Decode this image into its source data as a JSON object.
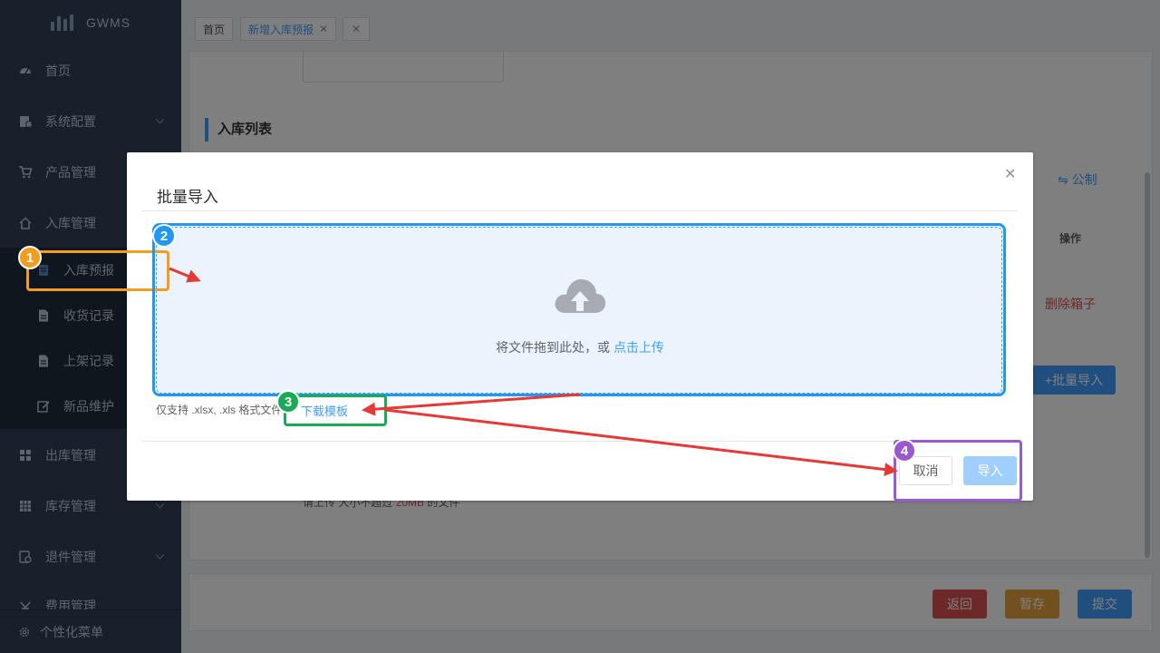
{
  "app": {
    "logo_text": "GWMS"
  },
  "sidebar": {
    "items": [
      {
        "label": "首页",
        "icon": "dashboard-icon"
      },
      {
        "label": "系统配置",
        "icon": "config-icon"
      },
      {
        "label": "产品管理",
        "icon": "cart-icon"
      },
      {
        "label": "入库管理",
        "icon": "home-icon"
      },
      {
        "label": "出库管理",
        "icon": "grid-icon"
      },
      {
        "label": "库存管理",
        "icon": "table-icon"
      },
      {
        "label": "退件管理",
        "icon": "return-icon"
      },
      {
        "label": "费用管理",
        "icon": "yen-icon"
      }
    ],
    "subitems": [
      {
        "label": "入库预报",
        "icon": "forecast-icon"
      },
      {
        "label": "收货记录",
        "icon": "document-icon"
      },
      {
        "label": "上架记录",
        "icon": "document-icon"
      },
      {
        "label": "新品维护",
        "icon": "edit-icon"
      }
    ],
    "footer_label": "个性化菜单"
  },
  "tabs": [
    {
      "label": "首页"
    },
    {
      "label": "新增入库预报"
    }
  ],
  "page": {
    "section_title": "入库列表",
    "bg_texts": {
      "link_partial": "⇋ 公制",
      "column_header": "操作",
      "delete_box": "删除箱子",
      "batch_import": "+批量导入",
      "upload_hint_prefix": "请上传 大小不超过",
      "upload_hint_size": "20MB",
      "upload_hint_suffix": "的文件"
    },
    "bottom_buttons": {
      "back": "返回",
      "save_draft": "暂存",
      "submit": "提交"
    }
  },
  "dialog": {
    "title": "批量导入",
    "upload_text": "将文件拖到此处，或",
    "upload_link": "点击上传",
    "tip": "仅支持 .xlsx, .xls 格式文件",
    "download_template": "下载模板",
    "cancel_label": "取消",
    "import_label": "导入"
  },
  "annotations": [
    {
      "number": "1",
      "color": "#f39c1f"
    },
    {
      "number": "2",
      "color": "#2196f3"
    },
    {
      "number": "3",
      "color": "#1aaa55"
    },
    {
      "number": "4",
      "color": "#9b59d0"
    }
  ],
  "colors": {
    "sidebar_bg": "#304156",
    "submenu_bg": "#1f2d3d",
    "primary": "#409eff",
    "danger": "#d9534f",
    "warning": "#e6a23c",
    "arrow": "#e53935"
  }
}
